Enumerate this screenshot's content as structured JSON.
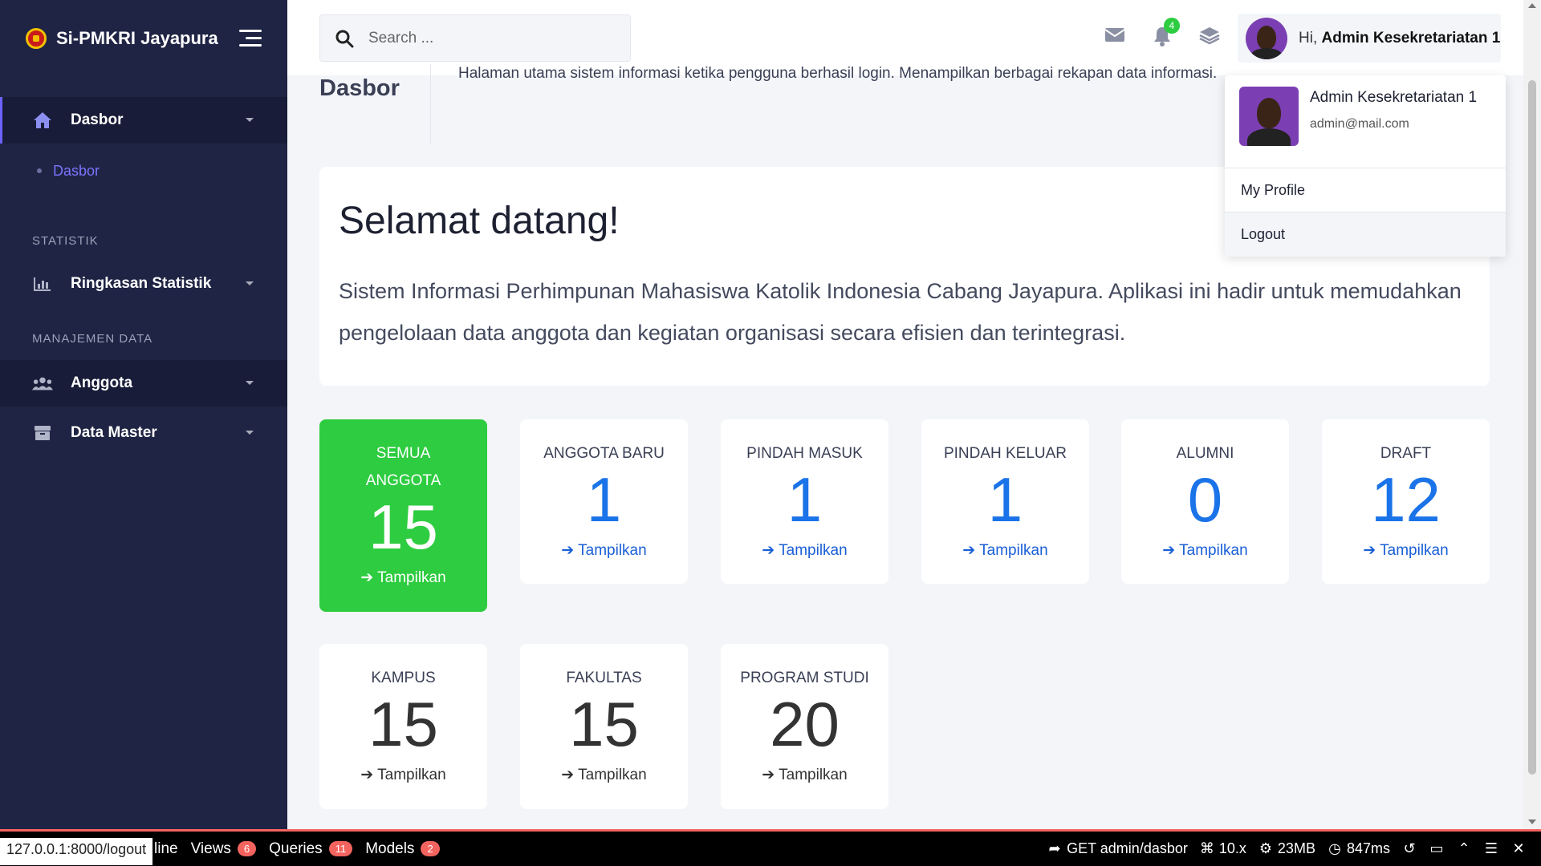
{
  "brand": {
    "name": "Si-PMKRI Jayapura"
  },
  "sidebar": {
    "dasbor_label": "Dasbor",
    "sub_dasbor": "Dasbor",
    "section_statistik": "STATISTIK",
    "ringkasan_label": "Ringkasan Statistik",
    "section_manajemen": "MANAJEMEN DATA",
    "anggota_label": "Anggota",
    "datamaster_label": "Data Master"
  },
  "search": {
    "placeholder": "Search ..."
  },
  "topbar": {
    "notif_count": "4",
    "greeting": "Hi,",
    "user_name": "Admin Kesekretariatan 1"
  },
  "page": {
    "title": "Dasbor",
    "description": "Halaman utama sistem informasi ketika pengguna berhasil login. Menampilkan berbagai rekapan data informasi."
  },
  "welcome": {
    "heading": "Selamat datang!",
    "text": "Sistem Informasi Perhimpunan Mahasiswa Katolik Indonesia Cabang Jayapura. Aplikasi ini hadir untuk memudahkan pengelolaan data anggota dan kegiatan organisasi secara efisien dan terintegrasi."
  },
  "stats": [
    {
      "label": "SEMUA ANGGOTA",
      "value": "15",
      "link": "Tampilkan"
    },
    {
      "label": "ANGGOTA BARU",
      "value": "1",
      "link": "Tampilkan"
    },
    {
      "label": "PINDAH MASUK",
      "value": "1",
      "link": "Tampilkan"
    },
    {
      "label": "PINDAH KELUAR",
      "value": "1",
      "link": "Tampilkan"
    },
    {
      "label": "ALUMNI",
      "value": "0",
      "link": "Tampilkan"
    },
    {
      "label": "DRAFT",
      "value": "12",
      "link": "Tampilkan"
    },
    {
      "label": "KAMPUS",
      "value": "15",
      "link": "Tampilkan"
    },
    {
      "label": "FAKULTAS",
      "value": "15",
      "link": "Tampilkan"
    },
    {
      "label": "PROGRAM STUDI",
      "value": "20",
      "link": "Tampilkan"
    }
  ],
  "dropdown": {
    "name": "Admin Kesekretariatan 1",
    "email": "admin@mail.com",
    "profile": "My Profile",
    "logout": "Logout"
  },
  "debugbar": {
    "url": "127.0.0.1:8000/logout",
    "tab_timeline": "line",
    "tab_views": "Views",
    "views_count": "6",
    "tab_queries": "Queries",
    "queries_count": "11",
    "tab_models": "Models",
    "models_count": "2",
    "route": "GET admin/dasbor",
    "version": "10.x",
    "memory": "23MB",
    "time": "847ms"
  },
  "colors": {
    "sidebar_bg": "#1f2444",
    "accent": "#6c63ff",
    "green": "#2ecc40",
    "link_blue": "#1a73e8"
  }
}
